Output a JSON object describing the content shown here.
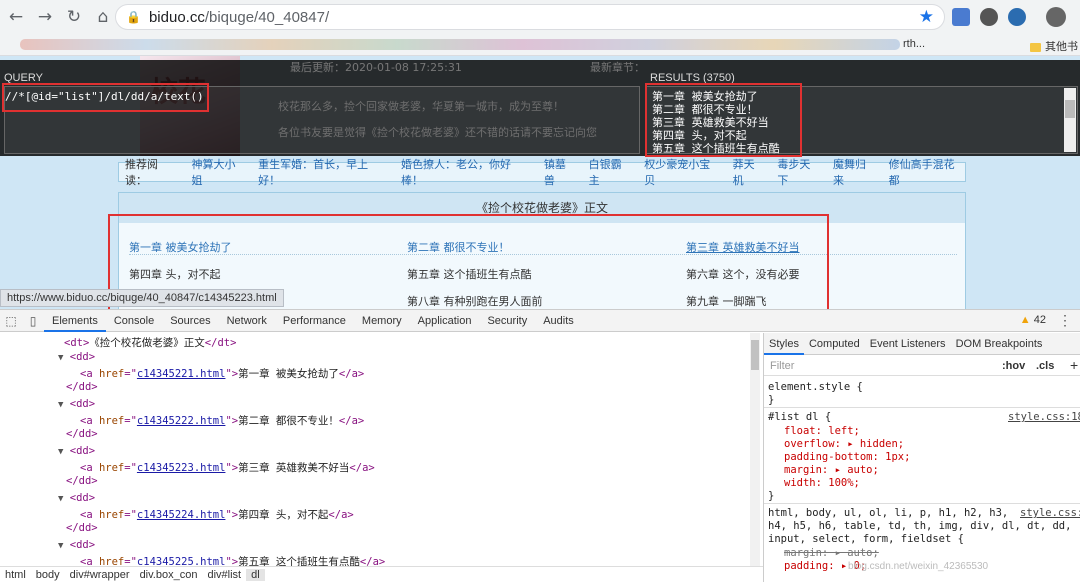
{
  "browser": {
    "url_host": "biduo.cc",
    "url_path": "/biquge/40_40847/",
    "bookmarks_partial": "rth...",
    "other_bookmarks": "其他书"
  },
  "page": {
    "cover_text": "校花",
    "recommend": {
      "label": "推荐阅读：",
      "links": [
        "神算大小姐",
        "重生军婚：首长，早上好！",
        "婚色撩人：老公，你好棒！",
        "镇墓兽",
        "白银霸主",
        "权少豪宠小宝贝",
        "莽天机",
        "毒步天下",
        "魔舞归来",
        "修仙高手混花都"
      ]
    },
    "list_title": "《捡个校花做老婆》正文",
    "chapters": [
      "第一章 被美女抢劫了",
      "第二章 都很不专业！",
      "第三章 英雄救美不好当",
      "第四章 头，对不起",
      "第五章 这个插班生有点酷",
      "第六章 这个，没有必要",
      "第八章 有种别跑在男人面前",
      "第九章 一脚踹飞"
    ],
    "bg_text": {
      "line1": "最后更新：2020-01-08 17:25:31",
      "line2": "最新章节：",
      "line3": "校花那么多，捡个回家做老婆，华夏第一城市，成为至尊！",
      "line4": "各位书友要是觉得《捡个校花做老婆》还不错的话请不要忘记向您"
    }
  },
  "xpath_helper": {
    "query_label": "QUERY",
    "query": "//*[@id=\"list\"]/dl/dd/a/text()",
    "results_label": "RESULTS (3750)",
    "results": [
      "第一章 被美女抢劫了",
      "第二章 都很不专业！",
      "第三章 英雄救美不好当",
      "第四章 头，对不起",
      "第五章 这个插班生有点酷"
    ]
  },
  "status_url": "https://www.biduo.cc/biquge/40_40847/c14345223.html",
  "devtools": {
    "tabs": [
      "Elements",
      "Console",
      "Sources",
      "Network",
      "Performance",
      "Memory",
      "Application",
      "Security",
      "Audits"
    ],
    "warning_count": "42",
    "dom": {
      "dt_line": "《捡个校花做老婆》正文",
      "items": [
        {
          "href": "c14345221.html",
          "text": "第一章 被美女抢劫了"
        },
        {
          "href": "c14345222.html",
          "text": "第二章 都很不专业！"
        },
        {
          "href": "c14345223.html",
          "text": "第三章 英雄救美不好当"
        },
        {
          "href": "c14345224.html",
          "text": "第四章 头，对不起"
        },
        {
          "href": "c14345225.html",
          "text": "第五章 这个插班生有点酷"
        }
      ]
    },
    "breadcrumbs": [
      "html",
      "body",
      "div#wrapper",
      "div.box_con",
      "div#list",
      "dl"
    ],
    "styles": {
      "tabs": [
        "Styles",
        "Computed",
        "Event Listeners",
        "DOM Breakpoints"
      ],
      "filter_placeholder": "Filter",
      "hov": ":hov",
      "cls": ".cls",
      "element_style": "element.style {",
      "rule1_selector": "#list dl {",
      "rule1_source": "style.css:18",
      "rule1_props": [
        "float: left;",
        "overflow: ▸ hidden;",
        "padding-bottom: 1px;",
        "margin: ▸ auto;",
        "width: 100%;"
      ],
      "rule2_selector": "html, body, ul, ol, li, p, h1, h2, h3,",
      "rule2_selector_b": "h4, h5, h6, table, td, th, img, div, dl, dt, dd,",
      "rule2_selector_c": "input, select, form, fieldset {",
      "rule2_source": "style.css:",
      "rule2_props": [
        "margin: ▸ auto;",
        "padding: ▸ 0;"
      ]
    }
  },
  "watermark": "blog.csdn.net/weixin_42365530"
}
